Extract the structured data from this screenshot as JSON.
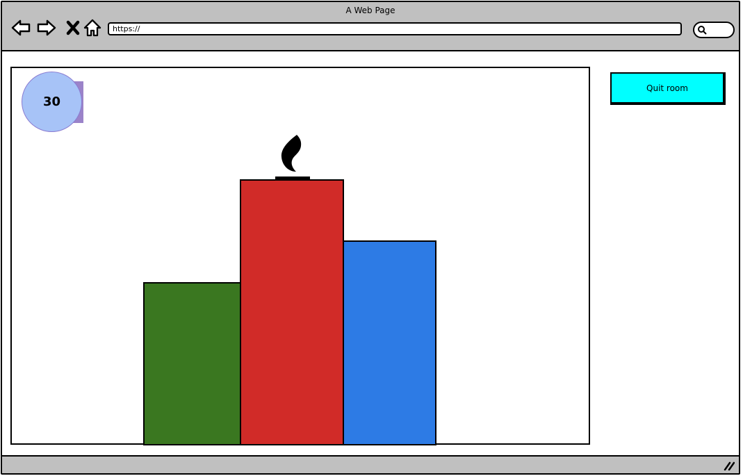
{
  "window": {
    "title": "A Web Page"
  },
  "toolbar": {
    "url": "https://",
    "icons": [
      "back-arrow-icon",
      "forward-arrow-icon",
      "close-x-icon",
      "home-icon",
      "search-icon"
    ]
  },
  "game": {
    "timer": "30",
    "quit_label": "Quit room",
    "podium": [
      {
        "place": "second",
        "color": "#3a7720"
      },
      {
        "place": "first",
        "color": "#d12b28",
        "icon": "flame-icon"
      },
      {
        "place": "third",
        "color": "#2d7be5"
      }
    ]
  },
  "colors": {
    "chrome": "#c0c0c0",
    "quit_button": "#00ffff",
    "timer_circle": "#a7c3f7",
    "timer_accent": "#9b83c9"
  }
}
